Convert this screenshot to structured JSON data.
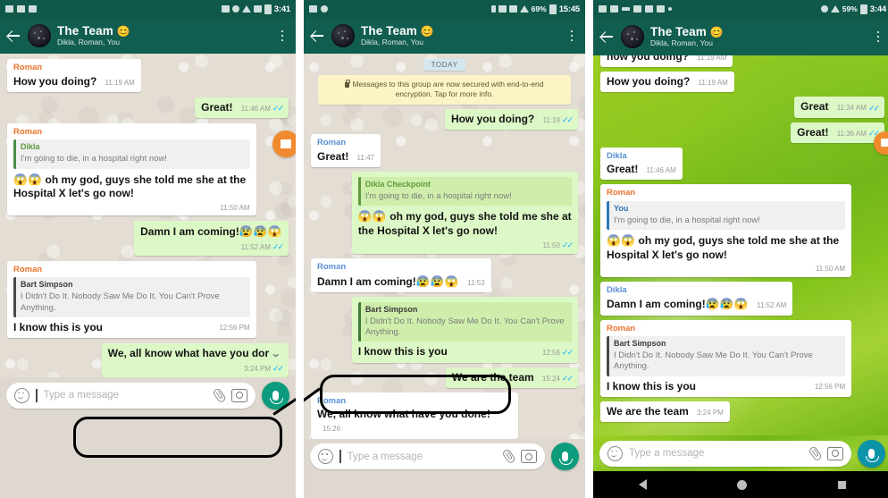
{
  "panels": [
    {
      "id": "panel-1",
      "status": {
        "time": "3:41",
        "battery": "",
        "icons": [
          "video-icon",
          "image-icon",
          "app-icon",
          "cast-icon",
          "dnd-icon",
          "wifi-icon",
          "sim-icon",
          "battery-icon"
        ]
      },
      "header": {
        "title": "The Team",
        "emoji": "😊",
        "subtitle": "Dikla, Roman, You"
      },
      "messages": [
        {
          "type": "in",
          "author": "Roman",
          "author_color": "orange",
          "text": "How you doing?",
          "time": "11:19 AM",
          "inline_time": true
        },
        {
          "type": "out",
          "text": "Great!",
          "time": "11:46 AM",
          "ticks": true,
          "inline_time": true
        },
        {
          "type": "in",
          "author": "Roman",
          "author_color": "orange",
          "quote": {
            "name": "Dikla",
            "name_color": "green",
            "text": "I'm going to die, in a hospital right now!"
          },
          "emoji": "😱😱",
          "text": "oh my god, guys she told me she at the Hospital X let's go now!",
          "time": "11:50 AM"
        },
        {
          "type": "out",
          "text": "Damn I am coming!",
          "emoji_after": "😰😰😱",
          "time": "11:52 AM",
          "ticks": true
        },
        {
          "type": "in",
          "author": "Roman",
          "author_color": "orange",
          "quote": {
            "name": "Bart Simpson",
            "name_color": "dark",
            "text": "I Didn't Do It. Nobody Saw Me Do It. You Can't Prove Anything."
          },
          "text": "I know this is you",
          "time": "12:56 PM"
        },
        {
          "type": "out",
          "text": "We, all know what have you dor",
          "truncated": true,
          "chevron": "⌄",
          "time": "3:24 PM",
          "ticks": true,
          "highlighted": true
        }
      ],
      "composer": {
        "placeholder": "Type a message",
        "icons": [
          "smiley-icon",
          "attach-icon",
          "camera-icon",
          "mic-icon"
        ]
      }
    },
    {
      "id": "panel-2",
      "status": {
        "time": "15:45",
        "battery": "69%",
        "icons": [
          "keyboard-icon",
          "mute-icon",
          "bluetooth-icon",
          "alarm-icon",
          "wifi-icon",
          "signal-icon",
          "battery-icon"
        ]
      },
      "header": {
        "title": "The Team",
        "emoji": "😊",
        "subtitle": "Dikla, Roman, You"
      },
      "day_divider": "TODAY",
      "notice": "Messages to this group are now secured with end-to-end encryption. Tap for more info.",
      "messages": [
        {
          "type": "out",
          "text": "How you doing?",
          "time": "11:19",
          "ticks": true,
          "inline_time": true
        },
        {
          "type": "in",
          "author": "Roman",
          "author_color": "blue",
          "text": "Great!",
          "time": "11:47",
          "inline_time": true
        },
        {
          "type": "out",
          "quote": {
            "name": "Dikla Checkpoint",
            "name_color": "green",
            "text": "I'm going to die, in a hospital right now!"
          },
          "emoji": "😱😱",
          "text": "oh my god, guys she told me she at the Hospital X let's go now!",
          "time": "11:50",
          "ticks": true
        },
        {
          "type": "in",
          "author": "Roman",
          "author_color": "blue",
          "text": "Damn I am coming!",
          "emoji_after": "😰😰😱",
          "time": "11:53",
          "inline_time": true
        },
        {
          "type": "out",
          "quote": {
            "name": "Bart Simpson",
            "name_color": "dark",
            "text": "I Didn't Do It. Nobody Saw Me Do It. You Can't Prove Anything."
          },
          "text": "I know this is you",
          "time": "12:56",
          "ticks": true
        },
        {
          "type": "out",
          "text": "We are the team",
          "time": "15:24",
          "ticks": true,
          "inline_time": true
        },
        {
          "type": "in",
          "author": "Roman",
          "author_color": "blue",
          "text": "We, all know what have you done!",
          "time": "15:26",
          "inline_time": true,
          "highlighted": true
        }
      ],
      "composer": {
        "placeholder": "Type a message",
        "icons": [
          "smiley-icon",
          "attach-icon",
          "camera-icon",
          "mic-icon"
        ]
      }
    },
    {
      "id": "panel-3",
      "status": {
        "time": "3:44",
        "battery": "59%",
        "icons": [
          "facebook-icon",
          "key-icon",
          "usb-icon",
          "photo-icon",
          "video-icon",
          "image-icon",
          "dot-icon",
          "alarm-icon",
          "signal-icon",
          "battery-icon"
        ]
      },
      "header": {
        "title": "The Team",
        "emoji": "😊",
        "subtitle": "Dikla, Roman, You"
      },
      "messages": [
        {
          "type": "in",
          "text": "how you doing?",
          "time": "11:19 AM",
          "inline_time": true,
          "clipped": true
        },
        {
          "type": "in",
          "text": "How you doing?",
          "time": "11:19 AM",
          "inline_time": true
        },
        {
          "type": "out",
          "text": "Great",
          "time": "11:34 AM",
          "ticks": true,
          "inline_time": true
        },
        {
          "type": "out",
          "text": "Great!",
          "time": "11:36 AM",
          "ticks": true,
          "inline_time": true
        },
        {
          "type": "in",
          "author": "Dikla",
          "author_color": "blue",
          "text": "Great!",
          "time": "11:46 AM",
          "inline_time": true
        },
        {
          "type": "in",
          "author": "Roman",
          "author_color": "orange",
          "quote": {
            "name": "You",
            "name_color": "blue",
            "text": "I'm going to die, in a hospital right now!"
          },
          "emoji": "😱😱",
          "text": "oh my god, guys she told me she at the Hospital X let's go now!",
          "time": "11:50 AM"
        },
        {
          "type": "in",
          "author": "Dikla",
          "author_color": "blue",
          "text": "Damn I am coming!",
          "emoji_after": "😰😰😱",
          "time": "11:52 AM",
          "inline_time": true
        },
        {
          "type": "in",
          "author": "Roman",
          "author_color": "orange",
          "quote": {
            "name": "Bart Simpson",
            "name_color": "dark",
            "text": "I Didn't Do It. Nobody Saw Me Do It. You Can't Prove Anything."
          },
          "text": "I know this is you",
          "time": "12:56 PM"
        },
        {
          "type": "in",
          "text": "We are the team",
          "time": "3:24 PM",
          "inline_time": true
        }
      ],
      "composer": {
        "placeholder": "Type a message",
        "icons": [
          "smiley-icon",
          "attach-icon",
          "camera-icon",
          "mic-icon"
        ]
      },
      "navbar": {
        "items": [
          "back-nav",
          "home-nav",
          "recents-nav"
        ]
      }
    }
  ],
  "colors": {
    "header_green": "#115e50",
    "status_green": "#10584a",
    "outgoing_bubble": "#dcf8c6",
    "incoming_bubble": "#ffffff",
    "author_orange": "#e8742c",
    "author_blue": "#5a8fd6",
    "tick_blue": "#4fc3f7",
    "notice_yellow": "#fdf4c6",
    "mic_green": "#0c9b7c",
    "mic_teal": "#0b93a8",
    "highlight_outline": "#000000"
  }
}
